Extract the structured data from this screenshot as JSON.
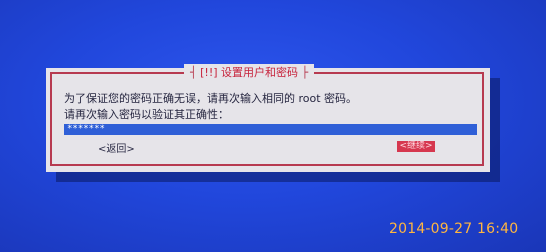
{
  "dialog": {
    "title_marker": "[!!]",
    "title": "设置用户和密码",
    "message_line1": "为了保证您的密码正确无误，请再次输入相同的 root 密码。",
    "message_line2": "请再次输入密码以验证其正确性：",
    "password_value": "*******",
    "back_button": "<返回>",
    "continue_button": "<继续>"
  },
  "photo_timestamp": "2014-09-27 16:40",
  "colors": {
    "screen_background": "#2147dc",
    "dialog_background": "#e6e4e9",
    "frame_border": "#b73a50",
    "title_text": "#c7223b",
    "input_background": "#2f5fd7",
    "continue_button_background": "#d6374f",
    "timestamp_text": "#ffb640"
  }
}
